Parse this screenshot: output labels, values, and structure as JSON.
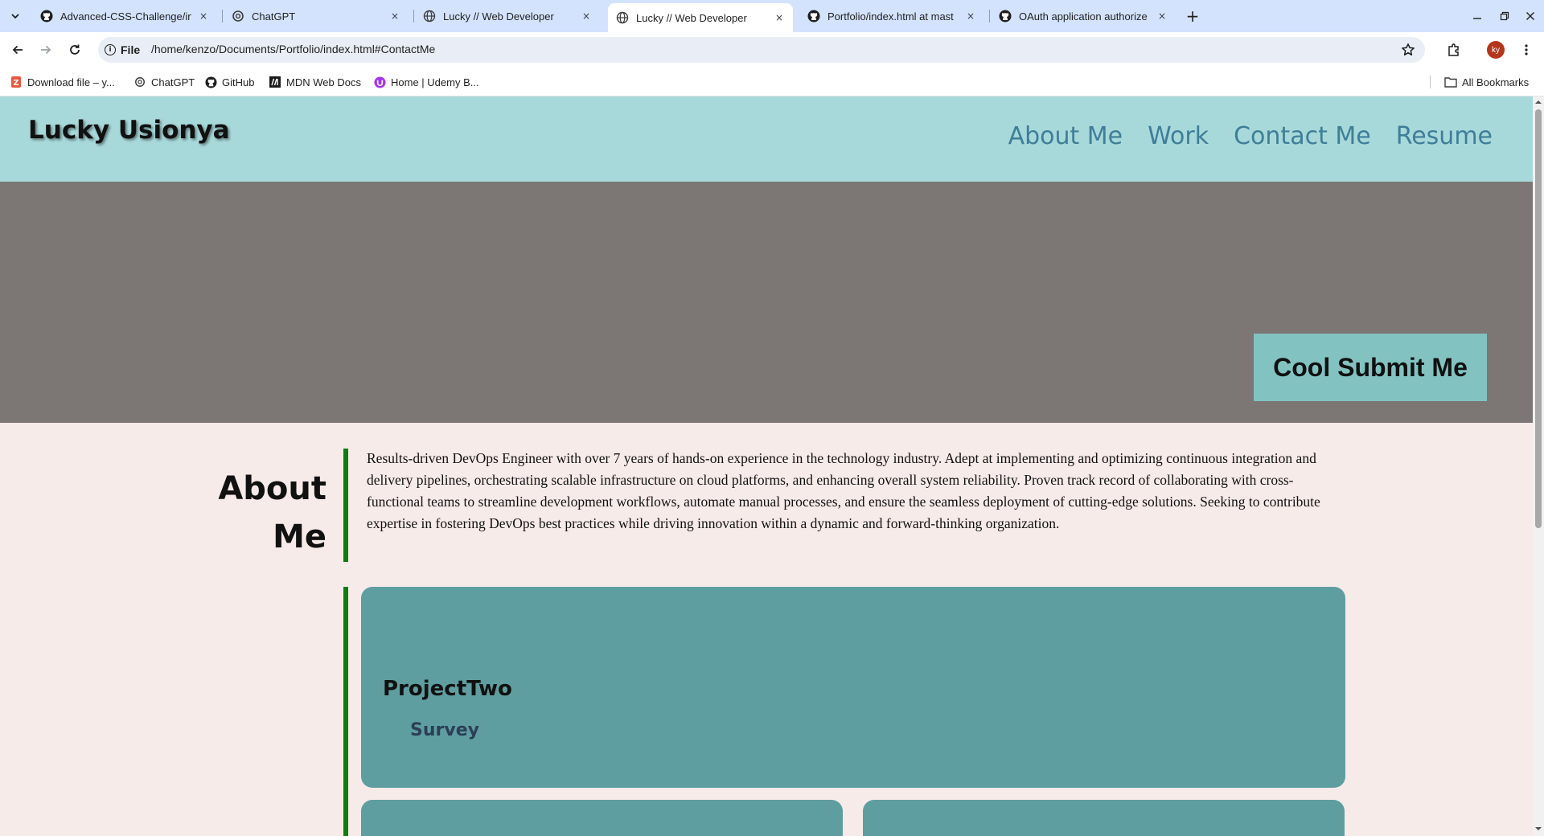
{
  "browser": {
    "tabs": [
      {
        "title": "Advanced-CSS-Challenge/ind",
        "icon": "github-icon",
        "active": false
      },
      {
        "title": "ChatGPT",
        "icon": "chatgpt-icon",
        "active": false
      },
      {
        "title": "Lucky // Web Developer",
        "icon": "globe-icon",
        "active": false
      },
      {
        "title": "Lucky // Web Developer",
        "icon": "globe-icon",
        "active": true
      },
      {
        "title": "Portfolio/index.html at mast",
        "icon": "github-icon",
        "active": false
      },
      {
        "title": "OAuth application authorize",
        "icon": "github-icon",
        "active": false
      }
    ],
    "new_tab_label": "+",
    "close_glyph": "×",
    "address": {
      "chip_label": "File",
      "url": "/home/kenzo/Documents/Portfolio/index.html#ContactMe"
    },
    "profile_initials": "ky",
    "bookmarks": [
      {
        "label": "Download file – y...",
        "icon": "zipcloud-icon"
      },
      {
        "label": "ChatGPT",
        "icon": "chatgpt-icon"
      },
      {
        "label": "GitHub",
        "icon": "github-icon"
      },
      {
        "label": "MDN Web Docs",
        "icon": "mdn-icon"
      },
      {
        "label": "Home | Udemy B...",
        "icon": "udemy-icon"
      }
    ],
    "all_bookmarks_label": "All Bookmarks"
  },
  "site": {
    "name": "Lucky Usionya",
    "nav": [
      "About Me",
      "Work",
      "Contact Me",
      "Resume"
    ],
    "hero_button": "Cool Submit Me",
    "about": {
      "title": "About Me",
      "text": "Results-driven DevOps Engineer with over 7 years of hands-on experience in the technology industry. Adept at implementing and optimizing continuous integration and delivery pipelines, orchestrating scalable infrastructure on cloud platforms, and enhancing overall system reliability. Proven track record of collaborating with cross-functional teams to streamline development workflows, automate manual processes, and ensure the seamless deployment of cutting-edge solutions. Seeking to contribute expertise in fostering DevOps best practices while driving innovation within a dynamic and forward-thinking organization."
    },
    "projects": [
      {
        "title": "ProjectTwo",
        "subtitle": "Survey"
      }
    ]
  },
  "colors": {
    "header_bg": "#a8d9da",
    "nav_link": "#3f7e98",
    "hero_bg": "#7c7674",
    "button_bg": "#82c3c1",
    "page_bg": "#f7ebe9",
    "accent_bar": "#0d7d0d",
    "card_bg": "#5f9ea0"
  }
}
